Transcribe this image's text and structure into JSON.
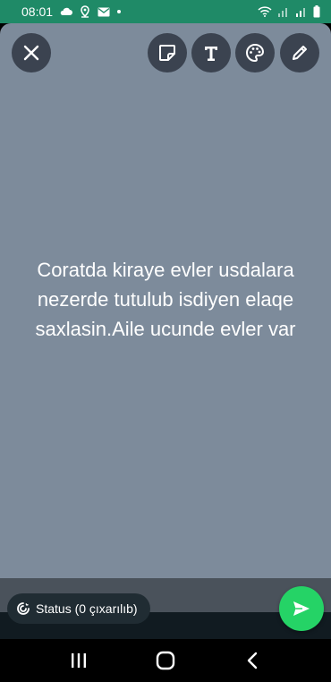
{
  "statusbar": {
    "time": "08:01",
    "left_icons": [
      "cloud-icon",
      "location-icon",
      "mail-icon",
      "dot-icon"
    ],
    "right_icons": [
      "wifi-icon",
      "signal-icon-1",
      "signal-icon-2",
      "battery-icon"
    ]
  },
  "toolbar": {
    "close": "close-icon",
    "sticker": "sticker-icon",
    "text": "text-icon",
    "palette": "palette-icon",
    "pencil": "pencil-icon"
  },
  "status_post": {
    "text": "Coratda kiraye evler usdalara nezerde tutulub isdiyen elaqe saxlasin.Aile ucunde evler var",
    "background_color": "#7d8b9b"
  },
  "audience": {
    "label": "Status (0 çıxarılıb)"
  },
  "send": {
    "icon": "send-icon",
    "color": "#25d366"
  },
  "navbar": {
    "recent": "recent-apps-icon",
    "home": "home-icon",
    "back": "back-icon"
  }
}
